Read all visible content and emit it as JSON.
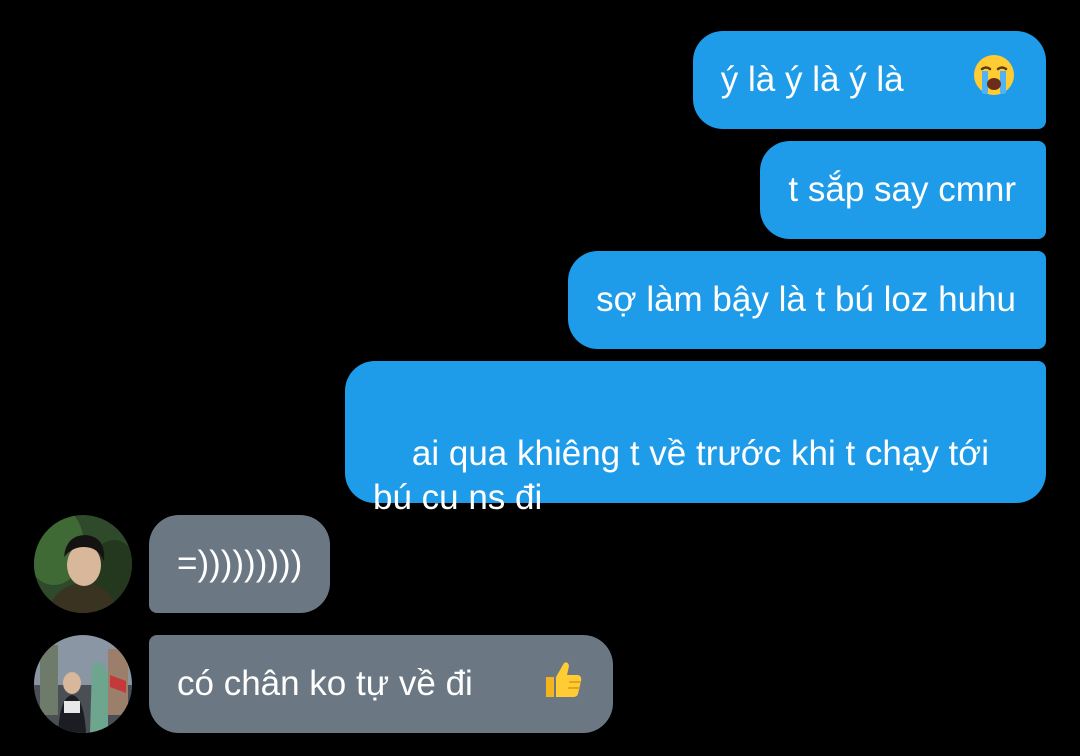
{
  "conversation": {
    "outgoing": [
      {
        "text": "ý là ý là ý là",
        "emoji": "loudly-crying-face-icon"
      },
      {
        "text": "t sắp say cmnr"
      },
      {
        "text": "sợ làm bậy là t bú loz huhu"
      },
      {
        "text": "ai qua khiêng t về trước khi t chạy tới\nbú cu ns đi"
      }
    ],
    "incoming": [
      {
        "text": "=)))))))))"
      },
      {
        "text": "có chân ko tự về đi",
        "emoji": "thumbs-up-icon"
      }
    ]
  },
  "colors": {
    "background": "#000000",
    "outgoing_bubble": "#1e9ce9",
    "incoming_bubble": "#6b7883",
    "text": "#ffffff"
  }
}
